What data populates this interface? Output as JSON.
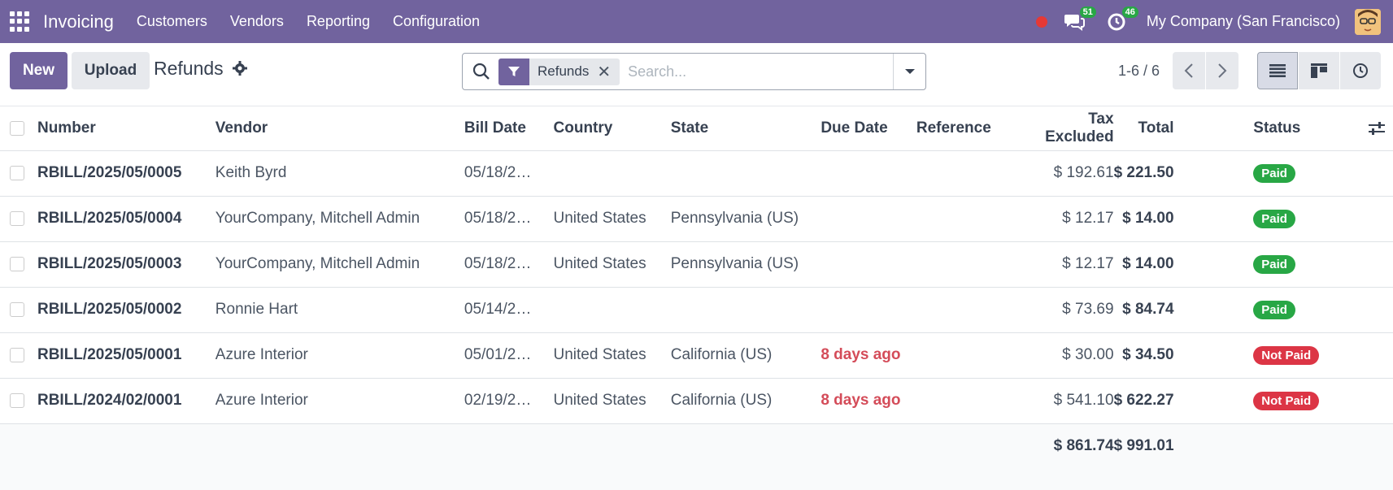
{
  "topbar": {
    "app_name": "Invoicing",
    "menu": [
      "Customers",
      "Vendors",
      "Reporting",
      "Configuration"
    ],
    "messages_count": "51",
    "activities_count": "46",
    "company": "My Company (San Francisco)",
    "color": "#71639e"
  },
  "control": {
    "new_label": "New",
    "upload_label": "Upload",
    "title": "Refunds",
    "facet_label": "Refunds",
    "search_placeholder": "Search...",
    "pager": "1-6 / 6"
  },
  "table": {
    "headers": [
      "Number",
      "Vendor",
      "Bill Date",
      "Country",
      "State",
      "Due Date",
      "Reference",
      "Tax Excluded",
      "Total",
      "Status"
    ],
    "rows": [
      {
        "number": "RBILL/2025/05/0005",
        "vendor": "Keith Byrd",
        "bill_date": "05/18/2…",
        "country": "",
        "state": "",
        "due_date": "",
        "reference": "",
        "tax_excluded": "$ 192.61",
        "total": "$ 221.50",
        "status": "Paid"
      },
      {
        "number": "RBILL/2025/05/0004",
        "vendor": "YourCompany, Mitchell Admin",
        "bill_date": "05/18/2…",
        "country": "United States",
        "state": "Pennsylvania (US)",
        "due_date": "",
        "reference": "",
        "tax_excluded": "$ 12.17",
        "total": "$ 14.00",
        "status": "Paid"
      },
      {
        "number": "RBILL/2025/05/0003",
        "vendor": "YourCompany, Mitchell Admin",
        "bill_date": "05/18/2…",
        "country": "United States",
        "state": "Pennsylvania (US)",
        "due_date": "",
        "reference": "",
        "tax_excluded": "$ 12.17",
        "total": "$ 14.00",
        "status": "Paid"
      },
      {
        "number": "RBILL/2025/05/0002",
        "vendor": "Ronnie Hart",
        "bill_date": "05/14/2…",
        "country": "",
        "state": "",
        "due_date": "",
        "reference": "",
        "tax_excluded": "$ 73.69",
        "total": "$ 84.74",
        "status": "Paid"
      },
      {
        "number": "RBILL/2025/05/0001",
        "vendor": "Azure Interior",
        "bill_date": "05/01/2…",
        "country": "United States",
        "state": "California (US)",
        "due_date": "8 days ago",
        "reference": "",
        "tax_excluded": "$ 30.00",
        "total": "$ 34.50",
        "status": "Not Paid"
      },
      {
        "number": "RBILL/2024/02/0001",
        "vendor": "Azure Interior",
        "bill_date": "02/19/2…",
        "country": "United States",
        "state": "California (US)",
        "due_date": "8 days ago",
        "reference": "",
        "tax_excluded": "$ 541.10",
        "total": "$ 622.27",
        "status": "Not Paid"
      }
    ],
    "totals": {
      "tax_excluded": "$ 861.74",
      "total": "$ 991.01"
    }
  },
  "colors": {
    "paid": "#28a745",
    "not_paid": "#dc3545",
    "overdue": "#d44c59"
  }
}
